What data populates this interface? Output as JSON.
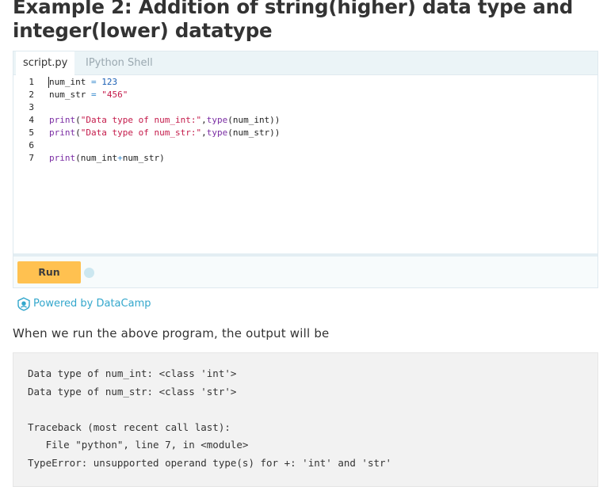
{
  "heading": "Example 2: Addition of string(higher) data type and integer(lower) datatype",
  "widget": {
    "tabs": [
      {
        "label": "script.py",
        "active": true
      },
      {
        "label": "IPython Shell",
        "active": false
      }
    ],
    "code_lines": [
      {
        "num": "1",
        "tokens": [
          {
            "t": "num_int ",
            "c": ""
          },
          {
            "t": "=",
            "c": "op"
          },
          {
            "t": " ",
            "c": ""
          },
          {
            "t": "123",
            "c": "num"
          }
        ]
      },
      {
        "num": "2",
        "tokens": [
          {
            "t": "num_str ",
            "c": ""
          },
          {
            "t": "=",
            "c": "op"
          },
          {
            "t": " ",
            "c": ""
          },
          {
            "t": "\"456\"",
            "c": "str"
          }
        ]
      },
      {
        "num": "3",
        "tokens": []
      },
      {
        "num": "4",
        "tokens": [
          {
            "t": "print",
            "c": "fn"
          },
          {
            "t": "(",
            "c": ""
          },
          {
            "t": "\"Data type of num_int:\"",
            "c": "str"
          },
          {
            "t": ",",
            "c": ""
          },
          {
            "t": "type",
            "c": "fn"
          },
          {
            "t": "(num_int))",
            "c": ""
          }
        ]
      },
      {
        "num": "5",
        "tokens": [
          {
            "t": "print",
            "c": "fn"
          },
          {
            "t": "(",
            "c": ""
          },
          {
            "t": "\"Data type of num_str:\"",
            "c": "str"
          },
          {
            "t": ",",
            "c": ""
          },
          {
            "t": "type",
            "c": "fn"
          },
          {
            "t": "(num_str))",
            "c": ""
          }
        ]
      },
      {
        "num": "6",
        "tokens": []
      },
      {
        "num": "7",
        "tokens": [
          {
            "t": "print",
            "c": "fn"
          },
          {
            "t": "(num_int",
            "c": ""
          },
          {
            "t": "+",
            "c": "op"
          },
          {
            "t": "num_str)",
            "c": ""
          }
        ]
      }
    ],
    "run_label": "Run"
  },
  "powered_by": "Powered by DataCamp",
  "paragraph": "When we run the above program, the output will be",
  "output_lines": [
    "Data type of num_int: <class 'int'>",
    "Data type of num_str: <class 'str'>",
    "",
    "Traceback (most recent call last):",
    "   File \"python\", line 7, in <module>",
    "TypeError: unsupported operand type(s) for +: 'int' and 'str'"
  ],
  "colors": {
    "run_button": "#ffc150",
    "link": "#33a7cc",
    "tab_bar": "#ebf4f7",
    "output_bg": "#f2f2f2"
  }
}
